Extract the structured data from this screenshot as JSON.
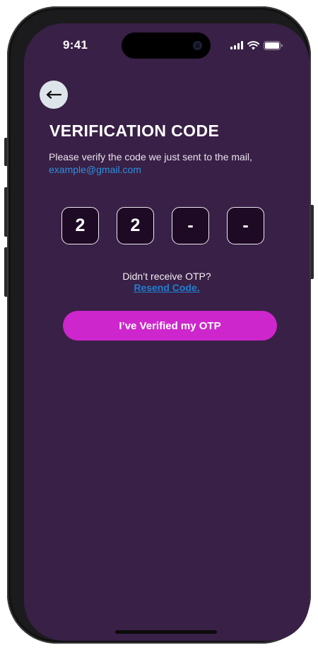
{
  "status_bar": {
    "time": "9:41"
  },
  "header": {
    "back_icon": "arrow-left-icon",
    "title": "VERIFICATION CODE",
    "subtitle": "Please verify the code we just sent to the mail,",
    "email": "example@gmail.com"
  },
  "otp": {
    "digits": [
      "2",
      "2",
      "-",
      "-"
    ]
  },
  "resend": {
    "question": "Didn’t receive OTP?",
    "link": "Resend Code."
  },
  "primary_button": {
    "label": "I’ve Verified my OTP"
  },
  "colors": {
    "screen_bg": "#392046",
    "otp_box_bg": "#1e0a24",
    "accent_button": "#cd26cc",
    "link": "#1f7fd0"
  }
}
